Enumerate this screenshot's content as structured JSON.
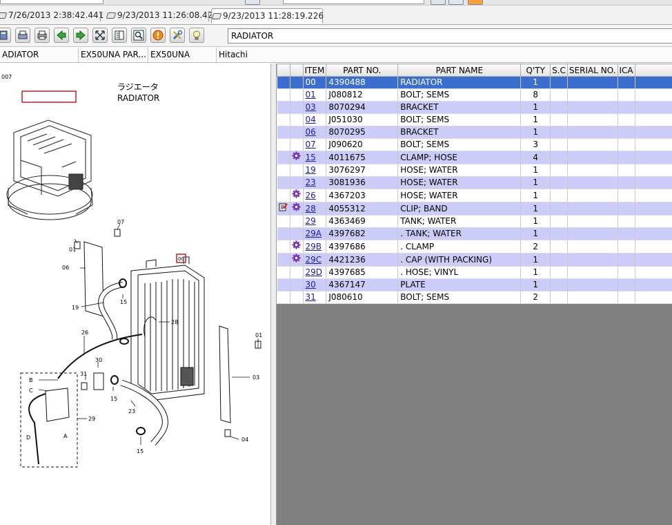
{
  "tabs": [
    {
      "label": "7/26/2013 2:38:42.441"
    },
    {
      "label": "9/23/2013 11:26:08.42"
    },
    {
      "label": "9/23/2013 11:28:19.226"
    }
  ],
  "toolbar": {
    "title_value": "RADIATOR",
    "buttons": [
      "book-icon",
      "printer-preview-icon",
      "print-icon",
      "arrow-back-icon",
      "arrow-forward-icon",
      "fit-screen-icon",
      "list-view-icon",
      "zoom-icon",
      "info-alert-icon",
      "tools-icon",
      "hint-bulb-icon"
    ]
  },
  "info_bar": {
    "name": "ADIATOR",
    "catalog": "EX50UNA  PAR...",
    "model": "EX50UNA",
    "maker": "Hitachi"
  },
  "diagram": {
    "page_no": "007",
    "title_jp": "ラジエータ",
    "title_en": "RADIATOR",
    "callouts": [
      "01",
      "07",
      "06",
      "19",
      "15",
      "28",
      "26",
      "30",
      "31",
      "15",
      "23",
      "15",
      "01",
      "03",
      "04",
      "29",
      "B",
      "C",
      "D",
      "A",
      "00"
    ]
  },
  "grid": {
    "headers": {
      "item": "ITEM",
      "part_no": "PART NO.",
      "part_name": "PART NAME",
      "qty": "Q'TY",
      "sc": "S.C",
      "serial_no": "SERIAL NO.",
      "ica": "ICA"
    },
    "rows": [
      {
        "item": "00",
        "part_no": "4390488",
        "part_name": "RADIATOR",
        "qty": "1",
        "note": false,
        "gear": false
      },
      {
        "item": "01",
        "part_no": "J080812",
        "part_name": "BOLT; SEMS",
        "qty": "8",
        "note": false,
        "gear": false
      },
      {
        "item": "03",
        "part_no": "8070294",
        "part_name": "BRACKET",
        "qty": "1",
        "note": false,
        "gear": false
      },
      {
        "item": "04",
        "part_no": "J051030",
        "part_name": "BOLT; SEMS",
        "qty": "1",
        "note": false,
        "gear": false
      },
      {
        "item": "06",
        "part_no": "8070295",
        "part_name": "BRACKET",
        "qty": "1",
        "note": false,
        "gear": false
      },
      {
        "item": "07",
        "part_no": "J090620",
        "part_name": "BOLT; SEMS",
        "qty": "3",
        "note": false,
        "gear": false
      },
      {
        "item": "15",
        "part_no": "4011675",
        "part_name": "CLAMP; HOSE",
        "qty": "4",
        "note": false,
        "gear": true
      },
      {
        "item": "19",
        "part_no": "3076297",
        "part_name": "HOSE; WATER",
        "qty": "1",
        "note": false,
        "gear": false
      },
      {
        "item": "23",
        "part_no": "3081936",
        "part_name": "HOSE; WATER",
        "qty": "1",
        "note": false,
        "gear": false
      },
      {
        "item": "26",
        "part_no": "4367203",
        "part_name": "HOSE; WATER",
        "qty": "1",
        "note": false,
        "gear": true
      },
      {
        "item": "28",
        "part_no": "4055312",
        "part_name": "CLIP; BAND",
        "qty": "1",
        "note": true,
        "gear": true
      },
      {
        "item": "29",
        "part_no": "4363469",
        "part_name": "TANK; WATER",
        "qty": "1",
        "note": false,
        "gear": false
      },
      {
        "item": "29A",
        "part_no": "4397682",
        "part_name": ". TANK; WATER",
        "qty": "1",
        "note": false,
        "gear": false
      },
      {
        "item": "29B",
        "part_no": "4397686",
        "part_name": ". CLAMP",
        "qty": "2",
        "note": false,
        "gear": true
      },
      {
        "item": "29C",
        "part_no": "4421236",
        "part_name": ". CAP (WITH PACKING)",
        "qty": "1",
        "note": false,
        "gear": true
      },
      {
        "item": "29D",
        "part_no": "4397685",
        "part_name": ". HOSE; VINYL",
        "qty": "1",
        "note": false,
        "gear": false
      },
      {
        "item": "30",
        "part_no": "4367147",
        "part_name": "PLATE",
        "qty": "1",
        "note": false,
        "gear": false
      },
      {
        "item": "31",
        "part_no": "J080610",
        "part_name": "BOLT; SEMS",
        "qty": "2",
        "note": false,
        "gear": false
      }
    ]
  },
  "colors": {
    "selected_row": "#3b6ecf",
    "alt_row": "#ccccf8",
    "grid_background": "#808080",
    "gear_icon": "#7a2fb0",
    "link": "#1a1aa8"
  }
}
